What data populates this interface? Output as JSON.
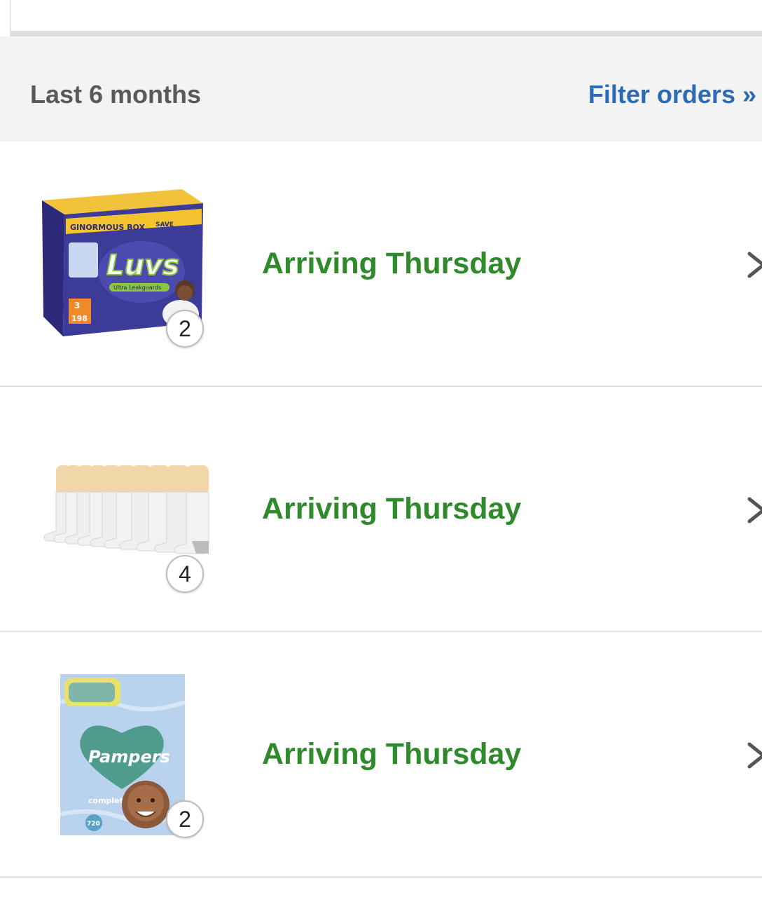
{
  "filter_bar": {
    "label": "Last 6 months",
    "link": "Filter orders »"
  },
  "orders": [
    {
      "product_image": "luvs-diapers-box",
      "box_lettering": [
        "GINORMOUS BOX",
        "SAVE",
        "Luvs",
        "Ultra Leakguards",
        "3",
        "198"
      ],
      "quantity": "2",
      "status": "Arriving Thursday",
      "icon": "chevron-right-icon"
    },
    {
      "product_image": "white-crew-socks-pack",
      "quantity": "4",
      "status": "Arriving Thursday",
      "icon": "chevron-right-icon"
    },
    {
      "product_image": "pampers-wipes-box",
      "box_lettering": [
        "Pampers",
        "complete clean",
        "720"
      ],
      "quantity": "2",
      "status": "Arriving Thursday",
      "icon": "chevron-right-icon"
    }
  ],
  "colors": {
    "status_green": "#2f8a2b",
    "link_blue": "#2c6bb3",
    "filter_bg": "#f3f3f3",
    "label_gray": "#595959"
  }
}
